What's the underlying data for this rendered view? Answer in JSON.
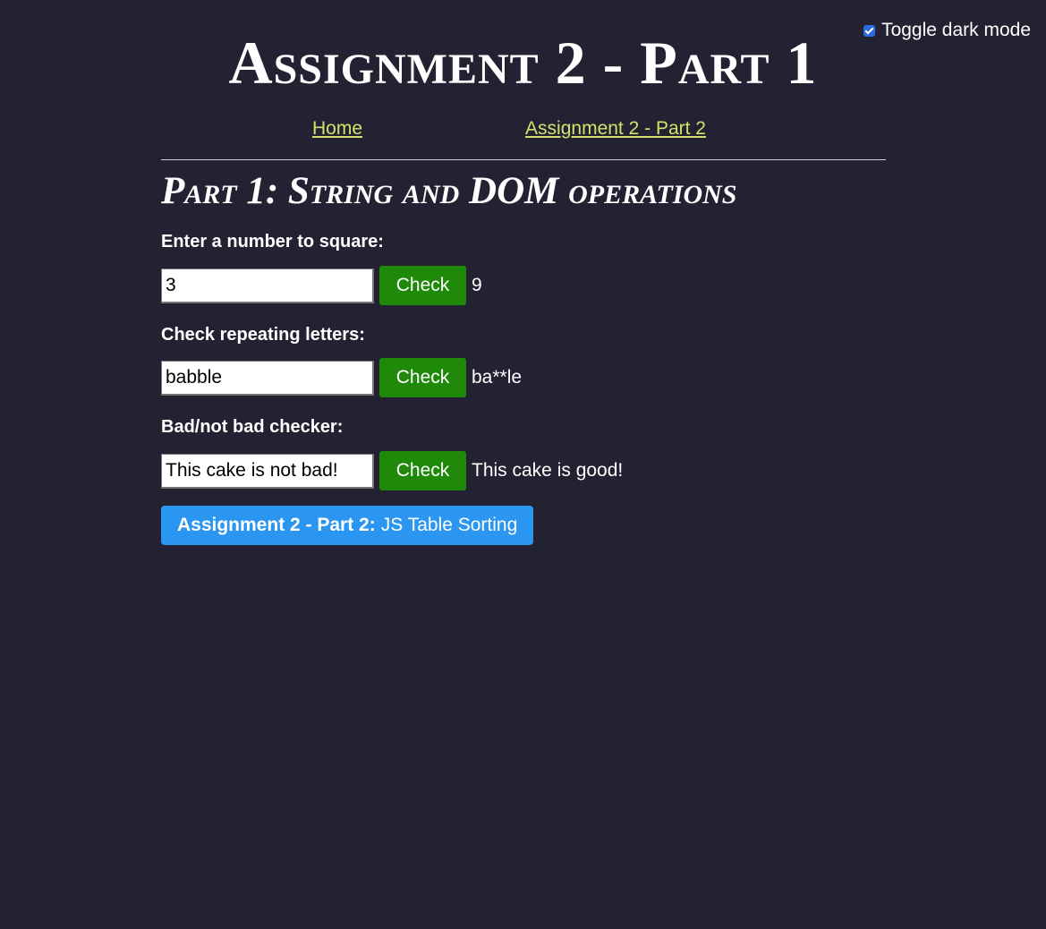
{
  "dark_mode": {
    "label": "Toggle dark mode",
    "checked": true
  },
  "header": {
    "title": "Assignment 2 - Part 1"
  },
  "nav": {
    "home": "Home",
    "part2": "Assignment 2 - Part 2"
  },
  "section": {
    "title": "Part 1: String and DOM operations"
  },
  "fields": [
    {
      "label": "Enter a number to square:",
      "value": "3",
      "button": "Check",
      "result": "9"
    },
    {
      "label": "Check repeating letters:",
      "value": "babble",
      "button": "Check",
      "result": "ba**le"
    },
    {
      "label": "Bad/not bad checker:",
      "value": "This cake is not bad!",
      "button": "Check",
      "result": "This cake is good!"
    }
  ],
  "part2_button": {
    "bold": "Assignment 2 - Part 2:",
    "text": "JS Table Sorting"
  },
  "colors": {
    "background": "#222233",
    "link": "#d6e06a",
    "check_button": "#1f8a0a",
    "part2_button": "#2b96f2"
  }
}
